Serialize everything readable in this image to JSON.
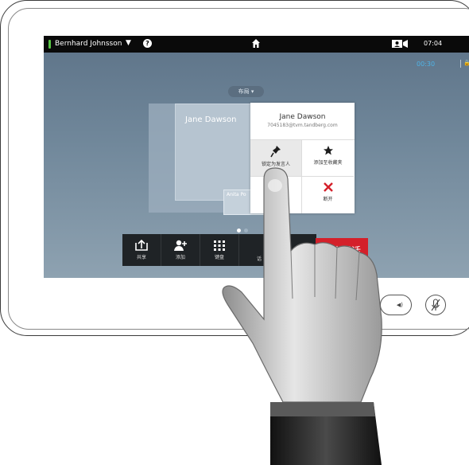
{
  "topbar": {
    "user_name": "Bernhard Johnsson",
    "caret": "▼",
    "help": "?",
    "time": "07:04"
  },
  "call": {
    "timer": "00:30",
    "lock": "🔒"
  },
  "layout_button": "布局 ▾",
  "participants": {
    "main_name": "Jane Dawson",
    "small_name": "Anita Po"
  },
  "popup": {
    "name": "Jane Dawson",
    "uri": "7045183@tvm.tandberg.com",
    "actions": [
      {
        "label": "锁定为发言人",
        "icon": "pin-icon"
      },
      {
        "label": "添加至收藏夹",
        "icon": "star-icon"
      },
      {
        "label": "",
        "icon": "blank"
      },
      {
        "label": "断开",
        "icon": "close-icon"
      }
    ]
  },
  "callbar": {
    "share": "共享",
    "add": "添加",
    "keypad": "键盘",
    "hidden": "话",
    "end_call": "结束通话"
  },
  "colors": {
    "accent_blue": "#4fb3e6",
    "end_call_red": "#d4202a",
    "status_green": "#57c443"
  }
}
